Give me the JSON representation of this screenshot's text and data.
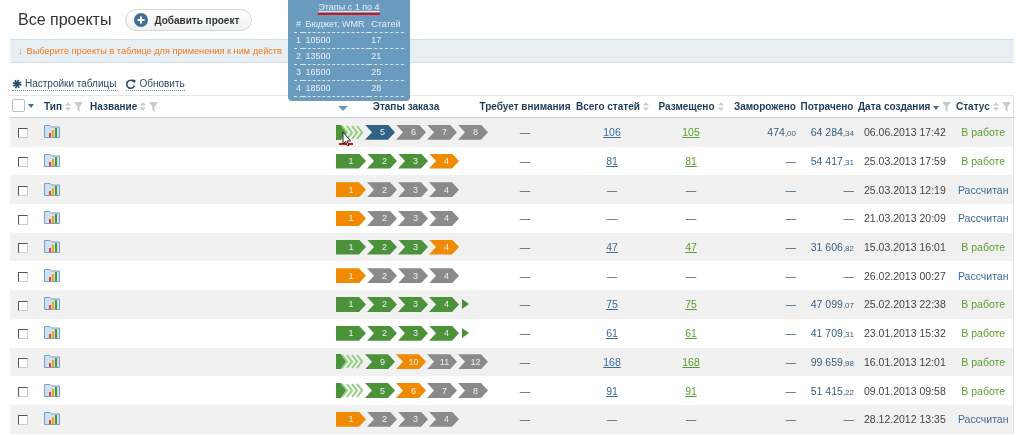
{
  "page": {
    "title": "Все проекты",
    "add_button": "Добавить проект"
  },
  "notice": {
    "arrow": "↓",
    "text": "Выберите проекты в таблице для применения к ним действ"
  },
  "toolbar": {
    "settings": "Настройки таблицы",
    "refresh": "Обновить"
  },
  "tooltip": {
    "title": "Этапы с 1 по 4",
    "columns": [
      "#",
      "Бюджет, WMR",
      "Статей"
    ],
    "rows": [
      [
        "1",
        "10500",
        "17"
      ],
      [
        "2",
        "13500",
        "21"
      ],
      [
        "3",
        "16500",
        "25"
      ],
      [
        "4",
        "18500",
        "28"
      ]
    ]
  },
  "table": {
    "select_all": {
      "checked": false
    },
    "columns": [
      {
        "label": "Тип",
        "sortable": true,
        "filterable": true
      },
      {
        "label": "Название",
        "sortable": true,
        "filterable": true
      },
      {
        "label": "Этапы заказа"
      },
      {
        "label": "Требует внимания"
      },
      {
        "label": "Всего статей",
        "sortable": true
      },
      {
        "label": "Размещено",
        "sortable": true
      },
      {
        "label": "Заморожено"
      },
      {
        "label": "Потрачено"
      },
      {
        "label": "Дата создания",
        "filterable": true,
        "sorted": true
      },
      {
        "label": "Статус",
        "sortable": true,
        "filterable": true
      }
    ],
    "rows": [
      {
        "checked": false,
        "collapsed": true,
        "continues": false,
        "stages": [
          {
            "label": "5",
            "color": "#2f6286"
          },
          {
            "label": "6",
            "color": "#8a8a8a"
          },
          {
            "label": "7",
            "color": "#8a8a8a"
          },
          {
            "label": "8",
            "color": "#8a8a8a"
          }
        ],
        "attention": "—",
        "linked": true,
        "total": "106",
        "placed": "105",
        "frozen": "474,00",
        "spent": "64 284,34",
        "created": "06.06.2013 17:42",
        "status": {
          "label": "В работе",
          "color": "#5a9e2f"
        }
      },
      {
        "checked": false,
        "collapsed": false,
        "continues": false,
        "stages": [
          {
            "label": "1",
            "color": "#4b923a"
          },
          {
            "label": "2",
            "color": "#4b923a"
          },
          {
            "label": "3",
            "color": "#4b923a"
          },
          {
            "label": "4",
            "color": "#f08a00"
          }
        ],
        "attention": "—",
        "linked": true,
        "total": "81",
        "placed": "81",
        "frozen": "—",
        "spent": "54 417,31",
        "created": "25.03.2013 17:59",
        "status": {
          "label": "В работе",
          "color": "#5a9e2f"
        }
      },
      {
        "checked": false,
        "collapsed": false,
        "continues": false,
        "stages": [
          {
            "label": "1",
            "color": "#f08a00"
          },
          {
            "label": "2",
            "color": "#8a8a8a"
          },
          {
            "label": "3",
            "color": "#8a8a8a"
          },
          {
            "label": "4",
            "color": "#8a8a8a"
          }
        ],
        "attention": "—",
        "linked": false,
        "total": "—",
        "placed": "—",
        "frozen": "—",
        "spent": "—",
        "created": "25.03.2013 12:19",
        "status": {
          "label": "Рассчитан",
          "color": "#3b6d99"
        }
      },
      {
        "checked": false,
        "collapsed": false,
        "continues": false,
        "stages": [
          {
            "label": "1",
            "color": "#f08a00"
          },
          {
            "label": "2",
            "color": "#8a8a8a"
          },
          {
            "label": "3",
            "color": "#8a8a8a"
          },
          {
            "label": "4",
            "color": "#8a8a8a"
          }
        ],
        "attention": "—",
        "linked": false,
        "total": "—",
        "placed": "—",
        "frozen": "—",
        "spent": "—",
        "created": "21.03.2013 20:09",
        "status": {
          "label": "Рассчитан",
          "color": "#3b6d99"
        }
      },
      {
        "checked": false,
        "collapsed": false,
        "continues": false,
        "stages": [
          {
            "label": "1",
            "color": "#4b923a"
          },
          {
            "label": "2",
            "color": "#4b923a"
          },
          {
            "label": "3",
            "color": "#4b923a"
          },
          {
            "label": "4",
            "color": "#f08a00"
          }
        ],
        "attention": "—",
        "linked": true,
        "total": "47",
        "placed": "47",
        "frozen": "—",
        "spent": "31 606,82",
        "created": "15.03.2013 16:01",
        "status": {
          "label": "В работе",
          "color": "#5a9e2f"
        }
      },
      {
        "checked": false,
        "collapsed": false,
        "continues": false,
        "stages": [
          {
            "label": "1",
            "color": "#f08a00"
          },
          {
            "label": "2",
            "color": "#8a8a8a"
          },
          {
            "label": "3",
            "color": "#8a8a8a"
          },
          {
            "label": "4",
            "color": "#8a8a8a"
          }
        ],
        "attention": "—",
        "linked": false,
        "total": "—",
        "placed": "—",
        "frozen": "—",
        "spent": "—",
        "created": "26.02.2013 00:27",
        "status": {
          "label": "Рассчитан",
          "color": "#3b6d99"
        }
      },
      {
        "checked": false,
        "collapsed": false,
        "continues": true,
        "stages": [
          {
            "label": "1",
            "color": "#4b923a"
          },
          {
            "label": "2",
            "color": "#4b923a"
          },
          {
            "label": "3",
            "color": "#4b923a"
          },
          {
            "label": "4",
            "color": "#4b923a"
          }
        ],
        "attention": "—",
        "linked": true,
        "total": "75",
        "placed": "75",
        "frozen": "—",
        "spent": "47 099,07",
        "created": "25.02.2013 22:38",
        "status": {
          "label": "В работе",
          "color": "#5a9e2f"
        }
      },
      {
        "checked": false,
        "collapsed": false,
        "continues": true,
        "stages": [
          {
            "label": "1",
            "color": "#4b923a"
          },
          {
            "label": "2",
            "color": "#4b923a"
          },
          {
            "label": "3",
            "color": "#4b923a"
          },
          {
            "label": "4",
            "color": "#4b923a"
          }
        ],
        "attention": "—",
        "linked": true,
        "total": "61",
        "placed": "61",
        "frozen": "—",
        "spent": "41 709,31",
        "created": "23.01.2013 15:32",
        "status": {
          "label": "В работе",
          "color": "#5a9e2f"
        }
      },
      {
        "checked": false,
        "collapsed": true,
        "continues": false,
        "stages": [
          {
            "label": "9",
            "color": "#4b923a"
          },
          {
            "label": "10",
            "color": "#f08a00"
          },
          {
            "label": "11",
            "color": "#8a8a8a"
          },
          {
            "label": "12",
            "color": "#8a8a8a"
          }
        ],
        "attention": "—",
        "linked": true,
        "total": "168",
        "placed": "168",
        "frozen": "—",
        "spent": "99 659,98",
        "created": "16.01.2013 12:01",
        "status": {
          "label": "В работе",
          "color": "#5a9e2f"
        }
      },
      {
        "checked": false,
        "collapsed": true,
        "continues": false,
        "stages": [
          {
            "label": "5",
            "color": "#4b923a"
          },
          {
            "label": "6",
            "color": "#f08a00"
          },
          {
            "label": "7",
            "color": "#8a8a8a"
          },
          {
            "label": "8",
            "color": "#8a8a8a"
          }
        ],
        "attention": "—",
        "linked": true,
        "total": "91",
        "placed": "91",
        "frozen": "—",
        "spent": "51 415,22",
        "created": "09.01.2013 09:58",
        "status": {
          "label": "В работе",
          "color": "#5a9e2f"
        }
      },
      {
        "checked": false,
        "collapsed": false,
        "continues": false,
        "stages": [
          {
            "label": "1",
            "color": "#f08a00"
          },
          {
            "label": "2",
            "color": "#8a8a8a"
          },
          {
            "label": "3",
            "color": "#8a8a8a"
          },
          {
            "label": "4",
            "color": "#8a8a8a"
          }
        ],
        "attention": "—",
        "linked": false,
        "total": "—",
        "placed": "—",
        "frozen": "—",
        "spent": "—",
        "created": "28.12.2012 13:35",
        "status": {
          "label": "Рассчитан",
          "color": "#3b6d99"
        }
      }
    ]
  }
}
